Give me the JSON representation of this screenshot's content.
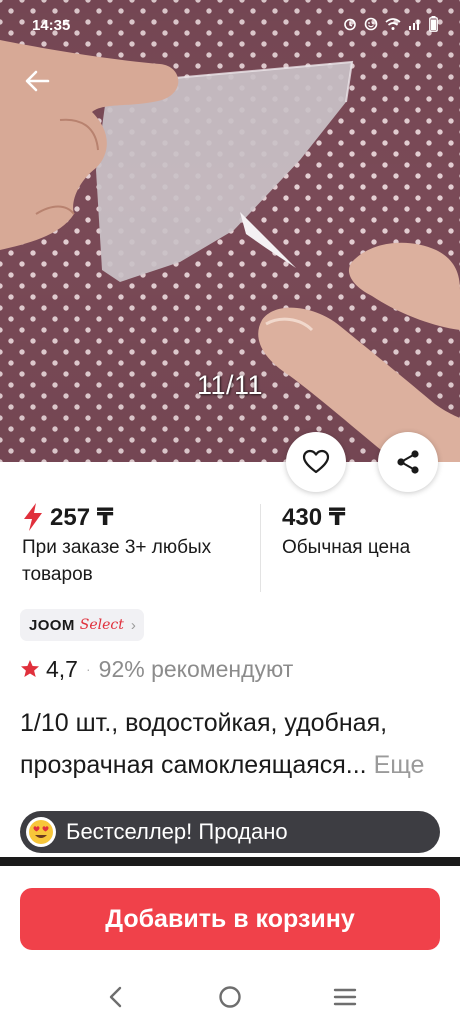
{
  "status_bar": {
    "time": "14:35",
    "icons": [
      "alarm-icon",
      "hotspot-icon",
      "wifi-icon",
      "signal-icon",
      "battery-icon"
    ]
  },
  "gallery": {
    "counter": "11/11",
    "colors": {
      "fabric": "#7a4a57",
      "dots": "#e4cfd3"
    }
  },
  "prices": {
    "bulk": {
      "value": "257 ₸",
      "caption": "При заказе 3+ любых товаров",
      "icon": "lightning-icon",
      "icon_color": "#e0303c"
    },
    "regular": {
      "value": "430 ₸",
      "caption": "Обычная цена"
    }
  },
  "joom_badge": {
    "brand": "JOOM",
    "select": "Select",
    "chevron": "›"
  },
  "rating": {
    "value": "4,7",
    "separator": "·",
    "recommend": "92% рекомендуют",
    "star_color": "#e0303c"
  },
  "product": {
    "title": "1/10 шт., водостойкая, удобная, прозрачная самоклеящаяся...",
    "more": "Еще"
  },
  "bestseller": {
    "emoji": "😍",
    "text": "Бестселлер! Продано"
  },
  "cart": {
    "label": "Добавить в корзину",
    "color": "#f0414a"
  },
  "nav": {
    "icons": [
      "back-icon",
      "home-icon",
      "recents-icon"
    ]
  }
}
